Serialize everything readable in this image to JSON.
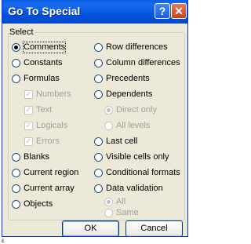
{
  "dialog": {
    "title": "Go To Special",
    "help_icon": "?",
    "close_icon": "✕"
  },
  "select_group": {
    "label": "Select"
  },
  "left_options": [
    {
      "label": "Comments",
      "checked": true
    },
    {
      "label": "Constants",
      "checked": false
    },
    {
      "label": "Formulas",
      "checked": false
    },
    {
      "label": "Numbers",
      "checkbox": true,
      "checked": true,
      "disabled": true
    },
    {
      "label": "Text",
      "checkbox": true,
      "checked": true,
      "disabled": true
    },
    {
      "label": "Logicals",
      "checkbox": true,
      "checked": true,
      "disabled": true
    },
    {
      "label": "Errors",
      "checkbox": true,
      "checked": true,
      "disabled": true
    },
    {
      "label": "Blanks",
      "checked": false
    },
    {
      "label": "Current region",
      "checked": false
    },
    {
      "label": "Current array",
      "checked": false
    },
    {
      "label": "Objects",
      "checked": false
    }
  ],
  "right_options": [
    {
      "label": "Row differences",
      "checked": false
    },
    {
      "label": "Column differences",
      "checked": false
    },
    {
      "label": "Precedents",
      "checked": false
    },
    {
      "label": "Dependents",
      "checked": false
    },
    {
      "label": "Direct only",
      "checked": true,
      "disabled": true
    },
    {
      "label": "All levels",
      "checked": false,
      "disabled": true
    },
    {
      "label": "Last cell",
      "checked": false
    },
    {
      "label": "Visible cells only",
      "checked": false
    },
    {
      "label": "Conditional formats",
      "checked": false
    },
    {
      "label": "Data validation",
      "checked": false
    },
    {
      "label": "All",
      "checked": true,
      "disabled": true
    },
    {
      "label": "Same",
      "checked": false,
      "disabled": true
    }
  ],
  "buttons": {
    "ok": "OK",
    "cancel": "Cancel"
  },
  "stray_text": "ε"
}
